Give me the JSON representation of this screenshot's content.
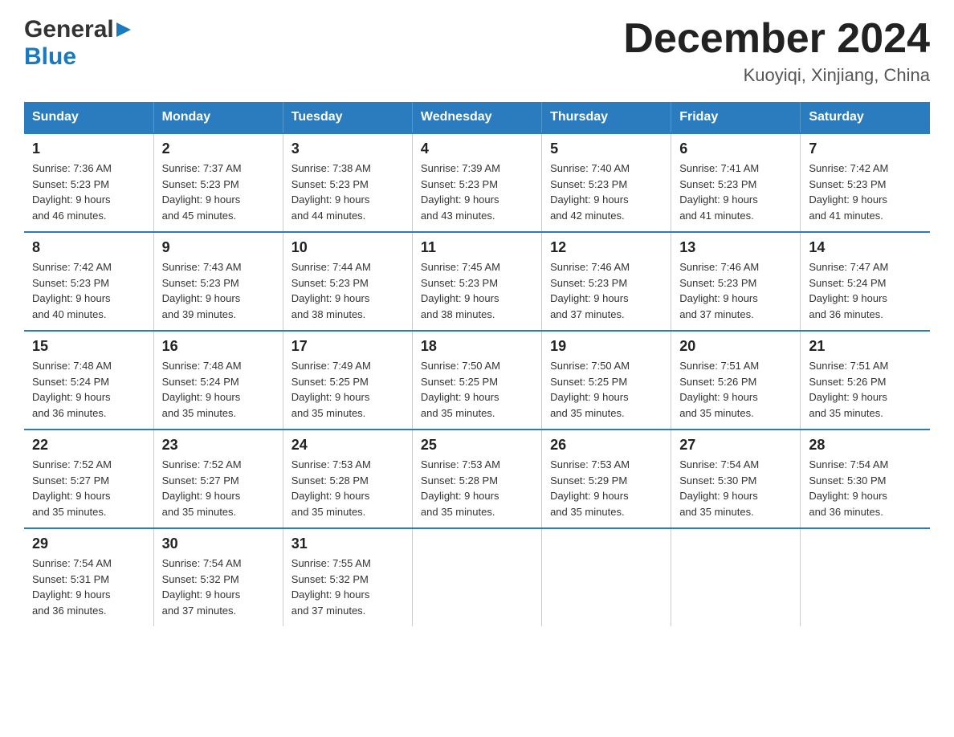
{
  "logo": {
    "general": "General",
    "blue": "Blue",
    "triangle": "▶"
  },
  "title": "December 2024",
  "location": "Kuoyiqi, Xinjiang, China",
  "days_of_week": [
    "Sunday",
    "Monday",
    "Tuesday",
    "Wednesday",
    "Thursday",
    "Friday",
    "Saturday"
  ],
  "weeks": [
    [
      {
        "day": "1",
        "sunrise": "7:36 AM",
        "sunset": "5:23 PM",
        "daylight": "9 hours and 46 minutes."
      },
      {
        "day": "2",
        "sunrise": "7:37 AM",
        "sunset": "5:23 PM",
        "daylight": "9 hours and 45 minutes."
      },
      {
        "day": "3",
        "sunrise": "7:38 AM",
        "sunset": "5:23 PM",
        "daylight": "9 hours and 44 minutes."
      },
      {
        "day": "4",
        "sunrise": "7:39 AM",
        "sunset": "5:23 PM",
        "daylight": "9 hours and 43 minutes."
      },
      {
        "day": "5",
        "sunrise": "7:40 AM",
        "sunset": "5:23 PM",
        "daylight": "9 hours and 42 minutes."
      },
      {
        "day": "6",
        "sunrise": "7:41 AM",
        "sunset": "5:23 PM",
        "daylight": "9 hours and 41 minutes."
      },
      {
        "day": "7",
        "sunrise": "7:42 AM",
        "sunset": "5:23 PM",
        "daylight": "9 hours and 41 minutes."
      }
    ],
    [
      {
        "day": "8",
        "sunrise": "7:42 AM",
        "sunset": "5:23 PM",
        "daylight": "9 hours and 40 minutes."
      },
      {
        "day": "9",
        "sunrise": "7:43 AM",
        "sunset": "5:23 PM",
        "daylight": "9 hours and 39 minutes."
      },
      {
        "day": "10",
        "sunrise": "7:44 AM",
        "sunset": "5:23 PM",
        "daylight": "9 hours and 38 minutes."
      },
      {
        "day": "11",
        "sunrise": "7:45 AM",
        "sunset": "5:23 PM",
        "daylight": "9 hours and 38 minutes."
      },
      {
        "day": "12",
        "sunrise": "7:46 AM",
        "sunset": "5:23 PM",
        "daylight": "9 hours and 37 minutes."
      },
      {
        "day": "13",
        "sunrise": "7:46 AM",
        "sunset": "5:23 PM",
        "daylight": "9 hours and 37 minutes."
      },
      {
        "day": "14",
        "sunrise": "7:47 AM",
        "sunset": "5:24 PM",
        "daylight": "9 hours and 36 minutes."
      }
    ],
    [
      {
        "day": "15",
        "sunrise": "7:48 AM",
        "sunset": "5:24 PM",
        "daylight": "9 hours and 36 minutes."
      },
      {
        "day": "16",
        "sunrise": "7:48 AM",
        "sunset": "5:24 PM",
        "daylight": "9 hours and 35 minutes."
      },
      {
        "day": "17",
        "sunrise": "7:49 AM",
        "sunset": "5:25 PM",
        "daylight": "9 hours and 35 minutes."
      },
      {
        "day": "18",
        "sunrise": "7:50 AM",
        "sunset": "5:25 PM",
        "daylight": "9 hours and 35 minutes."
      },
      {
        "day": "19",
        "sunrise": "7:50 AM",
        "sunset": "5:25 PM",
        "daylight": "9 hours and 35 minutes."
      },
      {
        "day": "20",
        "sunrise": "7:51 AM",
        "sunset": "5:26 PM",
        "daylight": "9 hours and 35 minutes."
      },
      {
        "day": "21",
        "sunrise": "7:51 AM",
        "sunset": "5:26 PM",
        "daylight": "9 hours and 35 minutes."
      }
    ],
    [
      {
        "day": "22",
        "sunrise": "7:52 AM",
        "sunset": "5:27 PM",
        "daylight": "9 hours and 35 minutes."
      },
      {
        "day": "23",
        "sunrise": "7:52 AM",
        "sunset": "5:27 PM",
        "daylight": "9 hours and 35 minutes."
      },
      {
        "day": "24",
        "sunrise": "7:53 AM",
        "sunset": "5:28 PM",
        "daylight": "9 hours and 35 minutes."
      },
      {
        "day": "25",
        "sunrise": "7:53 AM",
        "sunset": "5:28 PM",
        "daylight": "9 hours and 35 minutes."
      },
      {
        "day": "26",
        "sunrise": "7:53 AM",
        "sunset": "5:29 PM",
        "daylight": "9 hours and 35 minutes."
      },
      {
        "day": "27",
        "sunrise": "7:54 AM",
        "sunset": "5:30 PM",
        "daylight": "9 hours and 35 minutes."
      },
      {
        "day": "28",
        "sunrise": "7:54 AM",
        "sunset": "5:30 PM",
        "daylight": "9 hours and 36 minutes."
      }
    ],
    [
      {
        "day": "29",
        "sunrise": "7:54 AM",
        "sunset": "5:31 PM",
        "daylight": "9 hours and 36 minutes."
      },
      {
        "day": "30",
        "sunrise": "7:54 AM",
        "sunset": "5:32 PM",
        "daylight": "9 hours and 37 minutes."
      },
      {
        "day": "31",
        "sunrise": "7:55 AM",
        "sunset": "5:32 PM",
        "daylight": "9 hours and 37 minutes."
      },
      null,
      null,
      null,
      null
    ]
  ],
  "labels": {
    "sunrise_prefix": "Sunrise: ",
    "sunset_prefix": "Sunset: ",
    "daylight_prefix": "Daylight: "
  }
}
